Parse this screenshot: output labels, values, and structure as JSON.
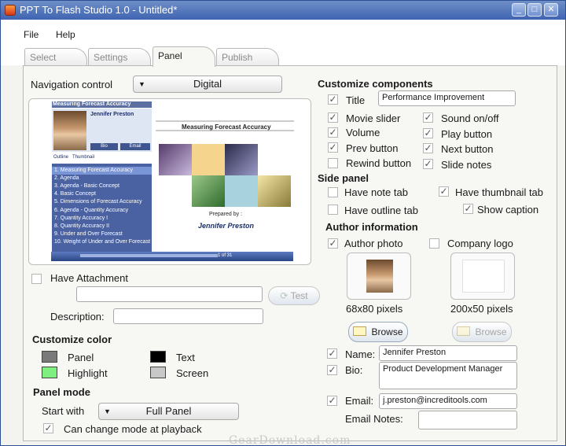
{
  "window": {
    "title": "PPT To Flash Studio 1.0 - Untitled*",
    "controls": {
      "minimize": "_",
      "maximize": "□",
      "close": "✕"
    }
  },
  "menu": {
    "file": "File",
    "help": "Help"
  },
  "tabs": [
    {
      "label": "Select"
    },
    {
      "label": "Settings"
    },
    {
      "label": "Panel"
    },
    {
      "label": "Publish"
    }
  ],
  "navigation": {
    "label": "Navigation control",
    "value": "Digital"
  },
  "preview": {
    "heading": "Measuring Forecast Accuracy",
    "presenter": "Jennifer Preston",
    "bio_tab": "Bio",
    "email_tab": "Email",
    "outline_tab": "Outline",
    "thumbnail_tab": "Thumbnail",
    "slide_title": "Measuring Forecast Accuracy",
    "prepared_by": "Prepared by :",
    "prepared_name": "Jennifer Preston",
    "counter": "1 of 31",
    "items": [
      "1. Measuring Forecast Accuracy",
      "2. Agenda",
      "3. Agenda - Basic Concept",
      "4. Basic Concept",
      "5. Dimensions of Forecast Accuracy",
      "6. Agenda - Quantity Accuracy",
      "7. Quantity Accuracy I",
      "8. Quantity Accuracy II",
      "9. Under and Over Forecast",
      "10. Weight of Under and Over Forecast"
    ]
  },
  "attachment": {
    "label": "Have Attachment",
    "checked": false,
    "path": "",
    "test_button": "Test",
    "description_label": "Description:",
    "description": ""
  },
  "customize_color": {
    "heading": "Customize color",
    "items": [
      {
        "label": "Panel",
        "color": "#7a7a7a"
      },
      {
        "label": "Text",
        "color": "#000000"
      },
      {
        "label": "Highlight",
        "color": "#7ff07f"
      },
      {
        "label": "Screen",
        "color": "#c8c8c8"
      }
    ]
  },
  "panel_mode": {
    "heading": "Panel mode",
    "start_label": "Start with",
    "start_value": "Full Panel",
    "change_label": "Can change mode at playback",
    "change_checked": true
  },
  "components": {
    "heading": "Customize components",
    "title": {
      "label": "Title",
      "checked": true,
      "value": "Performance Improvement"
    },
    "movie_slider": {
      "label": "Movie slider",
      "checked": true
    },
    "sound": {
      "label": "Sound on/off",
      "checked": true
    },
    "volume": {
      "label": "Volume",
      "checked": true
    },
    "play": {
      "label": "Play button",
      "checked": true
    },
    "prev": {
      "label": "Prev button",
      "checked": true
    },
    "next": {
      "label": "Next button",
      "checked": true
    },
    "rewind": {
      "label": "Rewind button",
      "checked": false
    },
    "notes": {
      "label": "Slide notes",
      "checked": true
    }
  },
  "side_panel": {
    "heading": "Side panel",
    "note_tab": {
      "label": "Have note tab",
      "checked": false
    },
    "thumbnail_tab": {
      "label": "Have thumbnail tab",
      "checked": true
    },
    "outline_tab": {
      "label": "Have outline tab",
      "checked": false
    },
    "caption": {
      "label": "Show caption",
      "checked": true
    }
  },
  "author": {
    "heading": "Author information",
    "photo": {
      "label": "Author photo",
      "checked": true,
      "size": "68x80 pixels",
      "browse": "Browse"
    },
    "logo": {
      "label": "Company logo",
      "checked": false,
      "size": "200x50 pixels",
      "browse": "Browse"
    },
    "name": {
      "label": "Name:",
      "checked": true,
      "value": "Jennifer Preston"
    },
    "bio": {
      "label": "Bio:",
      "checked": true,
      "value": "Product Development Manager"
    },
    "email": {
      "label": "Email:",
      "checked": true,
      "value": "j.preston@increditools.com"
    },
    "email_notes": {
      "label": "Email Notes:",
      "value": ""
    }
  },
  "watermark": "GearDownload.com"
}
